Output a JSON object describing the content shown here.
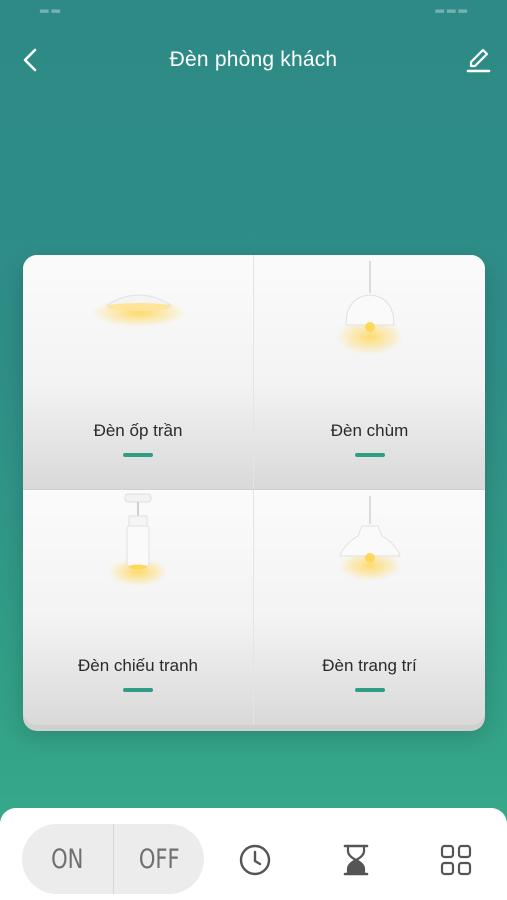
{
  "header": {
    "title": "Đèn phòng khách",
    "back_icon": "chevron-left-icon",
    "edit_icon": "pencil-icon"
  },
  "lights": [
    {
      "label": "Đèn ốp trần",
      "icon": "ceiling-light-icon",
      "state": "on"
    },
    {
      "label": "Đèn chùm",
      "icon": "pendant-lamp-icon",
      "state": "on"
    },
    {
      "label": "Đèn chiếu tranh",
      "icon": "spotlight-icon",
      "state": "on"
    },
    {
      "label": "Đèn trang trí",
      "icon": "decorative-pendant-icon",
      "state": "on"
    }
  ],
  "bottom_bar": {
    "on_label": "ON",
    "off_label": "OFF",
    "schedule_icon": "clock-icon",
    "timer_icon": "hourglass-icon",
    "scenes_icon": "grid-icon"
  },
  "colors": {
    "background": "#2f8e88",
    "accent": "#2e9e84",
    "glow": "#ffd75a"
  }
}
